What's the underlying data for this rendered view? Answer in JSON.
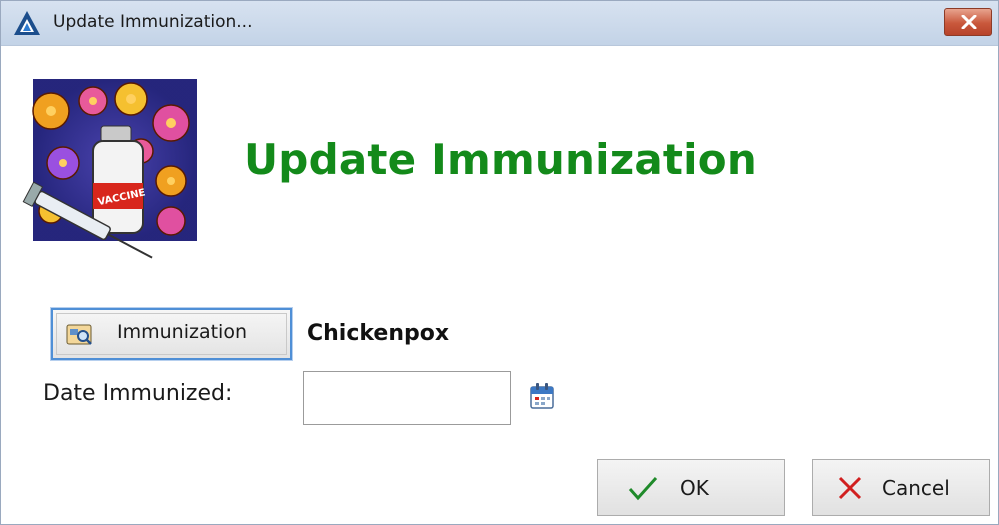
{
  "window": {
    "title": "Update Immunization...",
    "close_icon": "close-icon"
  },
  "header": {
    "heading": "Update Immunization",
    "image": "vaccine-illustration"
  },
  "form": {
    "immunization_button_label": "Immunization",
    "immunization_value": "Chickenpox",
    "date_label": "Date Immunized:",
    "date_value": "",
    "calendar_icon": "calendar-icon"
  },
  "buttons": {
    "ok_label": "OK",
    "cancel_label": "Cancel"
  },
  "colors": {
    "heading": "#138a1a",
    "titlebar": "#c8d7ea",
    "close_button": "#c9583c",
    "focus_border": "#4f8fd6"
  }
}
